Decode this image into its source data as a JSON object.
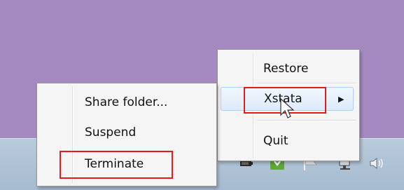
{
  "menu_main": {
    "items": [
      {
        "label": "Restore"
      },
      {
        "label": "Xstata",
        "submenu_arrow": "▶"
      },
      {
        "label": "Quit"
      }
    ]
  },
  "menu_sub": {
    "items": [
      {
        "label": "Share folder..."
      },
      {
        "label": "Suspend"
      },
      {
        "label": "Terminate"
      }
    ]
  },
  "colors": {
    "desktop": "#a48ac0",
    "highlight_box": "#e61a1a",
    "taskbar": "#b9cadb"
  },
  "icons": [
    "mouse-pointer-icon",
    "battery-icon",
    "shield-icon",
    "flag-icon",
    "network-icon",
    "speaker-icon"
  ]
}
